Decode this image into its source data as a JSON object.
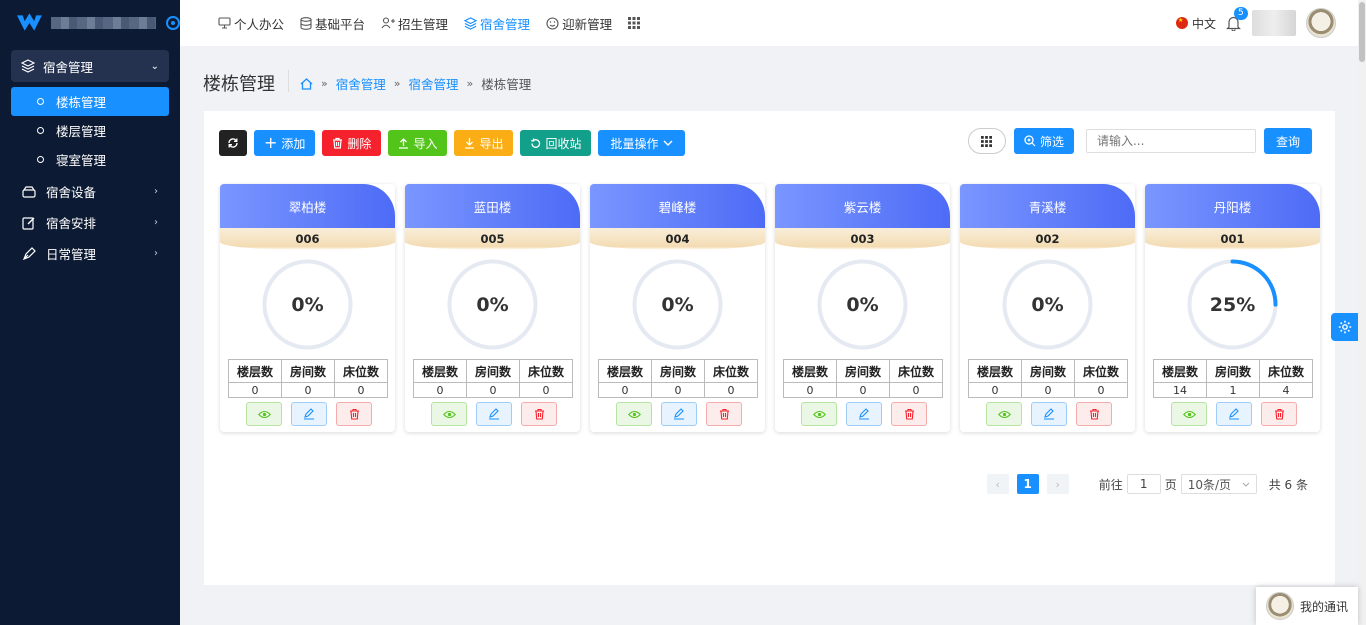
{
  "sidebar": {
    "group_label": "宿舍管理",
    "sub_items": [
      {
        "label": "楼栋管理",
        "active": true
      },
      {
        "label": "楼层管理",
        "active": false
      },
      {
        "label": "寝室管理",
        "active": false
      }
    ],
    "items": [
      {
        "label": "宿舍设备",
        "icon": "drive-icon"
      },
      {
        "label": "宿舍安排",
        "icon": "edit-icon"
      },
      {
        "label": "日常管理",
        "icon": "pen-icon"
      }
    ]
  },
  "header": {
    "nav": [
      {
        "label": "个人办公",
        "icon": "monitor-icon",
        "active": false
      },
      {
        "label": "基础平台",
        "icon": "database-icon",
        "active": false
      },
      {
        "label": "招生管理",
        "icon": "user-add-icon",
        "active": false
      },
      {
        "label": "宿舍管理",
        "icon": "layers-icon",
        "active": true
      },
      {
        "label": "迎新管理",
        "icon": "smile-icon",
        "active": false
      }
    ],
    "language": "中文",
    "notification_count": "5",
    "username_partial": "i...g"
  },
  "page": {
    "title": "楼栋管理",
    "breadcrumb": [
      "宿舍管理",
      "宿舍管理",
      "楼栋管理"
    ]
  },
  "toolbar": {
    "add": "添加",
    "delete": "删除",
    "import": "导入",
    "export": "导出",
    "recycle": "回收站",
    "batch": "批量操作",
    "filter": "筛选",
    "search_placeholder": "请输入...",
    "query": "查询"
  },
  "stat_headers": [
    "楼层数",
    "房间数",
    "床位数"
  ],
  "buildings": [
    {
      "name": "翠柏楼",
      "code": "006",
      "percent_label": "0%",
      "percent": 0,
      "floors": "0",
      "rooms": "0",
      "beds": "0"
    },
    {
      "name": "蓝田楼",
      "code": "005",
      "percent_label": "0%",
      "percent": 0,
      "floors": "0",
      "rooms": "0",
      "beds": "0"
    },
    {
      "name": "碧峰楼",
      "code": "004",
      "percent_label": "0%",
      "percent": 0,
      "floors": "0",
      "rooms": "0",
      "beds": "0"
    },
    {
      "name": "紫云楼",
      "code": "003",
      "percent_label": "0%",
      "percent": 0,
      "floors": "0",
      "rooms": "0",
      "beds": "0"
    },
    {
      "name": "青溪楼",
      "code": "002",
      "percent_label": "0%",
      "percent": 0,
      "floors": "0",
      "rooms": "0",
      "beds": "0"
    },
    {
      "name": "丹阳楼",
      "code": "001",
      "percent_label": "25%",
      "percent": 25,
      "floors": "14",
      "rooms": "1",
      "beds": "4"
    }
  ],
  "pagination": {
    "current": "1",
    "goto_label": "前往",
    "goto_value": "1",
    "page_unit": "页",
    "page_size": "10条/页",
    "total": "共 6 条"
  },
  "footer": {
    "chat_label": "我的通讯"
  },
  "colors": {
    "primary": "#1890ff",
    "sidebar_bg": "#0c1a33",
    "ring_track": "#e5e9f2"
  }
}
